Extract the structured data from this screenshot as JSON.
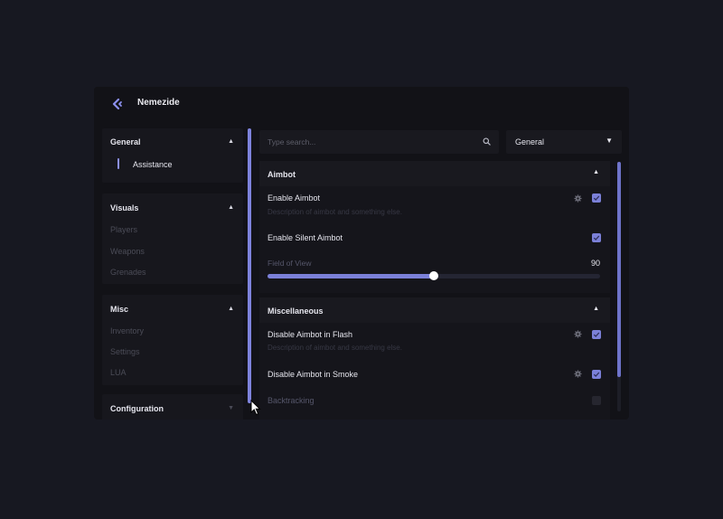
{
  "app": {
    "title": "Nemezide"
  },
  "colors": {
    "accent": "#7b80d8",
    "background": "#171821",
    "panel": "#121217"
  },
  "sidebar": {
    "groups": [
      {
        "title": "General",
        "expanded": true,
        "items": [
          {
            "label": "Assistance",
            "active": true
          }
        ]
      },
      {
        "title": "Visuals",
        "expanded": true,
        "items": [
          {
            "label": "Players"
          },
          {
            "label": "Weapons"
          },
          {
            "label": "Grenades"
          }
        ]
      },
      {
        "title": "Misc",
        "expanded": true,
        "items": [
          {
            "label": "Inventory"
          },
          {
            "label": "Settings"
          },
          {
            "label": "LUA"
          }
        ]
      },
      {
        "title": "Configuration",
        "expanded": false,
        "items": []
      }
    ]
  },
  "search": {
    "placeholder": "Type search..."
  },
  "filter": {
    "selected": "General"
  },
  "sections": [
    {
      "title": "Aimbot",
      "options": [
        {
          "label": "Enable Aimbot",
          "description": "Description of aimbot and something else.",
          "checked": true,
          "has_settings": true
        },
        {
          "label": "Enable Silent Aimbot",
          "checked": true,
          "has_settings": false
        }
      ],
      "slider": {
        "label": "Field of View",
        "value": "90",
        "fill_fraction": 0.5
      }
    },
    {
      "title": "Miscellaneous",
      "options": [
        {
          "label": "Disable Aimbot in Flash",
          "description": "Description of aimbot and something else.",
          "checked": true,
          "has_settings": true
        },
        {
          "label": "Disable Aimbot in Smoke",
          "checked": true,
          "has_settings": true
        },
        {
          "label": "Backtracking",
          "checked": false,
          "has_settings": false,
          "dimmed": true
        }
      ]
    }
  ],
  "icons": {
    "logo": "chevron-left-logo-icon",
    "search": "search-icon",
    "gear": "gear-icon",
    "check": "check-icon",
    "caret_up": "caret-up-icon",
    "caret_down": "caret-down-icon",
    "cursor": "mouse-cursor-icon"
  },
  "glyphs": {
    "caret_up": "▲",
    "caret_down": "▼"
  }
}
